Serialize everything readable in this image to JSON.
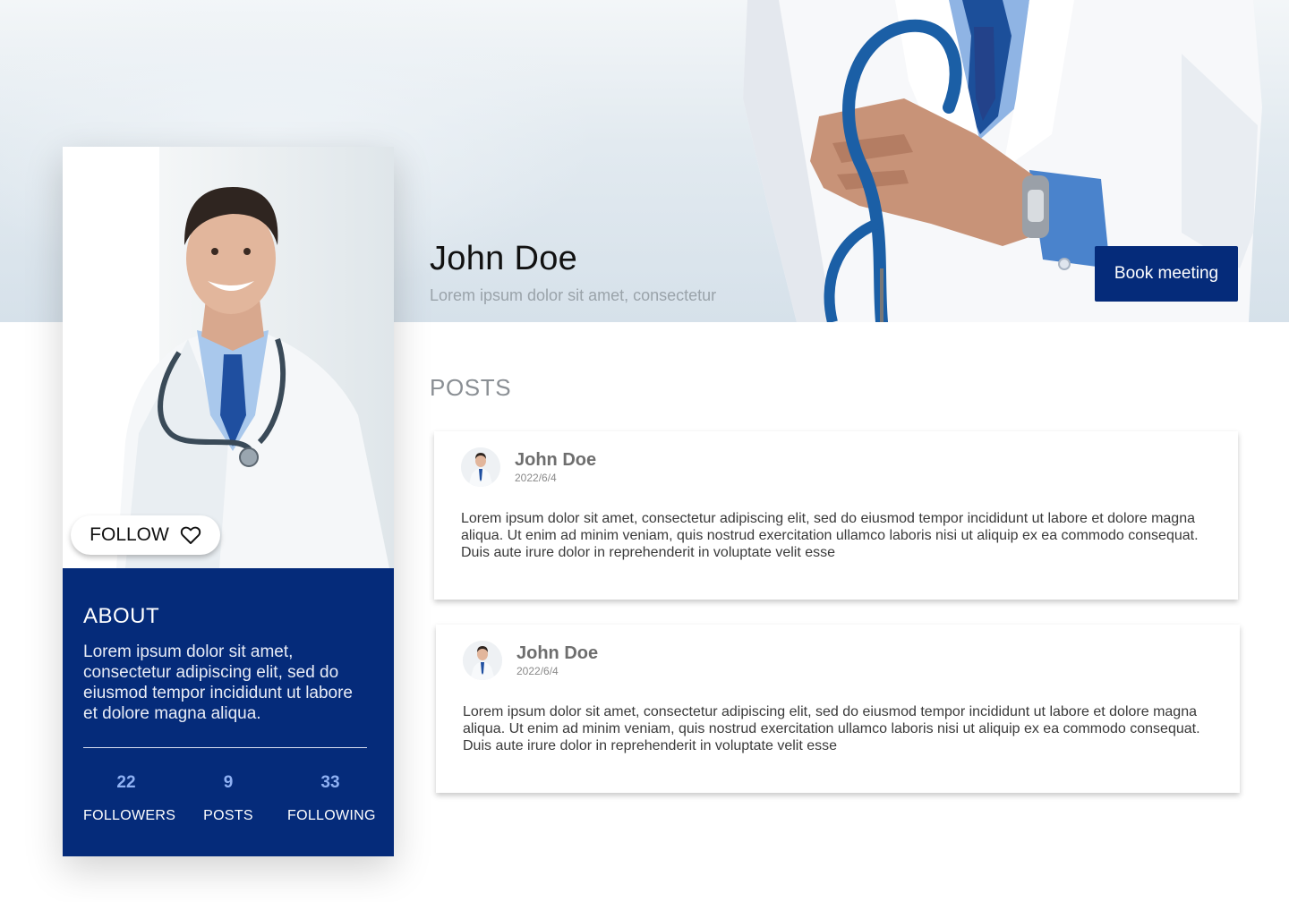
{
  "hero": {
    "name": "John Doe",
    "subtitle": "Lorem ipsum dolor sit amet, consectetur",
    "book_label": "Book meeting"
  },
  "profile": {
    "follow_label": "FOLLOW",
    "about_title": "ABOUT",
    "about_text": "Lorem ipsum dolor sit amet, consectetur adipiscing elit, sed do eiusmod tempor incididunt ut labore et dolore magna aliqua.",
    "stats": [
      {
        "value": "22",
        "label": "FOLLOWERS"
      },
      {
        "value": "9",
        "label": "POSTS"
      },
      {
        "value": "33",
        "label": "FOLLOWING"
      }
    ]
  },
  "posts": {
    "heading": "POSTS",
    "items": [
      {
        "author": "John Doe",
        "date": "2022/6/4",
        "body": "Lorem ipsum dolor sit amet, consectetur adipiscing elit, sed do eiusmod tempor incididunt ut labore et dolore magna aliqua. Ut enim ad minim veniam, quis nostrud exercitation ullamco laboris nisi ut aliquip ex ea commodo consequat. Duis aute irure dolor in reprehenderit in voluptate velit esse"
      },
      {
        "author": "John Doe",
        "date": "2022/6/4",
        "body": "Lorem ipsum dolor sit amet, consectetur adipiscing elit, sed do eiusmod tempor incididunt ut labore et dolore magna aliqua. Ut enim ad minim veniam, quis nostrud exercitation ullamco laboris nisi ut aliquip ex ea commodo consequat. Duis aute irure dolor in reprehenderit in voluptate velit esse"
      }
    ]
  },
  "colors": {
    "brand": "#052b7a",
    "stat_value": "#8fb1f3",
    "muted_text": "#9aa3aa"
  },
  "icons": {
    "follow": "heart-icon"
  }
}
